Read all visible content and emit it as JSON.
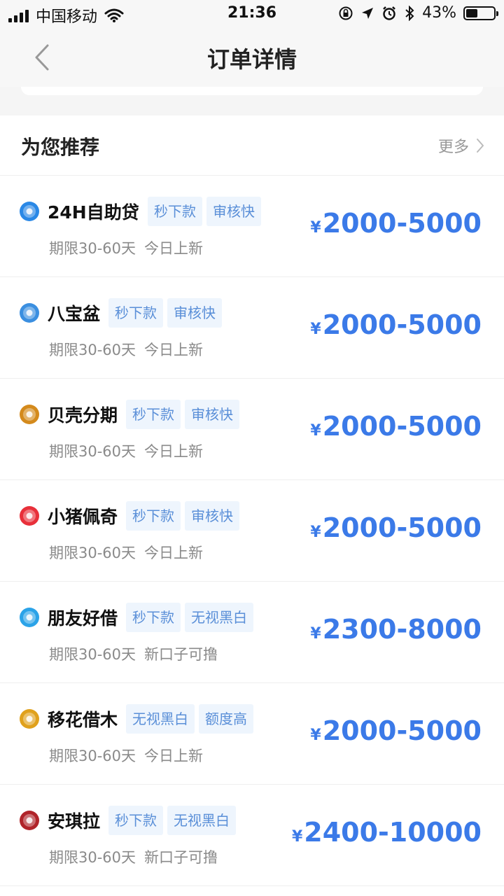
{
  "status_bar": {
    "carrier": "中国移动",
    "time": "21:36",
    "battery_percent": "43%",
    "battery_level": 0.43
  },
  "nav": {
    "title": "订单详情"
  },
  "recommend": {
    "title": "为您推荐",
    "more_label": "更多"
  },
  "items": [
    {
      "name": "24H自助贷",
      "tags": [
        "秒下款",
        "审核快"
      ],
      "period": "期限30-60天",
      "note": "今日上新",
      "currency": "¥",
      "amount": "2000-5000",
      "icon_color": "#2a88e6"
    },
    {
      "name": "八宝盆",
      "tags": [
        "秒下款",
        "审核快"
      ],
      "period": "期限30-60天",
      "note": "今日上新",
      "currency": "¥",
      "amount": "2000-5000",
      "icon_color": "#3b8fe0"
    },
    {
      "name": "贝壳分期",
      "tags": [
        "秒下款",
        "审核快"
      ],
      "period": "期限30-60天",
      "note": "今日上新",
      "currency": "¥",
      "amount": "2000-5000",
      "icon_color": "#d48a1c"
    },
    {
      "name": "小猪佩奇",
      "tags": [
        "秒下款",
        "审核快"
      ],
      "period": "期限30-60天",
      "note": "今日上新",
      "currency": "¥",
      "amount": "2000-5000",
      "icon_color": "#e8303a"
    },
    {
      "name": "朋友好借",
      "tags": [
        "秒下款",
        "无视黑白"
      ],
      "period": "期限30-60天",
      "note": "新口子可撸",
      "currency": "¥",
      "amount": "2300-8000",
      "icon_color": "#2ba3e8"
    },
    {
      "name": "移花借木",
      "tags": [
        "无视黑白",
        "额度高"
      ],
      "period": "期限30-60天",
      "note": "今日上新",
      "currency": "¥",
      "amount": "2000-5000",
      "icon_color": "#e0a11c"
    },
    {
      "name": "安琪拉",
      "tags": [
        "秒下款",
        "无视黑白"
      ],
      "period": "期限30-60天",
      "note": "新口子可撸",
      "currency": "¥",
      "amount": "2400-10000",
      "icon_color": "#b0242a"
    }
  ]
}
